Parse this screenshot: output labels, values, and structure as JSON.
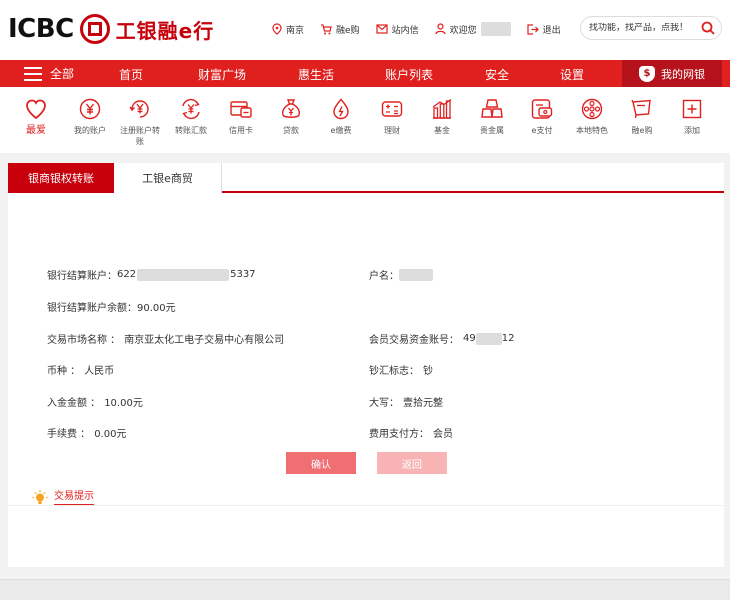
{
  "brand": {
    "logo_text": "ICBC",
    "logo_cn": "工银融e行",
    "accent": "#e0201e",
    "dark_red": "#c7000b"
  },
  "toplinks": [
    {
      "icon": "location-pin-icon",
      "label": "南京"
    },
    {
      "icon": "cart-icon",
      "label": "融e购"
    },
    {
      "icon": "mail-icon",
      "label": "站内信"
    },
    {
      "icon": "user-icon",
      "label": "欢迎您"
    },
    {
      "icon": "logout-icon",
      "label": "退出"
    }
  ],
  "search": {
    "placeholder": "找功能，找产品，点我！"
  },
  "nav": {
    "menu_label": "全部",
    "items": [
      "首页",
      "财富广场",
      "惠生活",
      "账户列表",
      "安全",
      "设置"
    ],
    "my_bank": "我的网银"
  },
  "shortcuts": [
    {
      "icon": "heart-icon",
      "label": "最爱"
    },
    {
      "icon": "yuan-coin-icon",
      "label": "我的账户"
    },
    {
      "icon": "yuan-register-icon",
      "label": "注册账户转账"
    },
    {
      "icon": "yuan-transfer-icon",
      "label": "转账汇款"
    },
    {
      "icon": "credit-card-icon",
      "label": "信用卡"
    },
    {
      "icon": "money-bag-icon",
      "label": "贷款"
    },
    {
      "icon": "flame-icon",
      "label": "e缴费"
    },
    {
      "icon": "calculator-icon",
      "label": "理财"
    },
    {
      "icon": "bar-chart-icon",
      "label": "基金"
    },
    {
      "icon": "gold-bars-icon",
      "label": "贵金属"
    },
    {
      "icon": "e-pay-icon",
      "label": "e支付"
    },
    {
      "icon": "local-film-icon",
      "label": "本地特色"
    },
    {
      "icon": "shopping-bag-icon",
      "label": "融e购"
    },
    {
      "icon": "plus-square-icon",
      "label": "添加"
    }
  ],
  "tabs": {
    "active": "银商银权转账",
    "other": "工银e商贸"
  },
  "form": {
    "settle_account_label": "银行结算账户：",
    "settle_account_prefix": "622",
    "settle_account_suffix": "5337",
    "account_name_label": "户名：",
    "balance_label": "银行结算账户余额：",
    "balance_value": "90.00元",
    "market_label": "交易市场名称 ：",
    "market_value": "南京亚太化工电子交易中心有限公司",
    "fund_account_label": "会员交易资金账号：",
    "fund_account_prefix": "49",
    "fund_account_suffix": "12",
    "currency_label": "币种 ：",
    "currency_value": "人民币",
    "cash_flag_label": "钞汇标志：",
    "cash_flag_value": "钞",
    "amount_label": "入金金额 ：",
    "amount_value": "10.00元",
    "amount_upper_label": "大写：",
    "amount_upper_value": "壹拾元整",
    "fee_label": "手续费 ：",
    "fee_value": "0.00元",
    "payer_label": "费用支付方：",
    "payer_value": "会员"
  },
  "buttons": {
    "confirm": "确认",
    "back": "返回"
  },
  "tip": {
    "label": "交易提示"
  }
}
